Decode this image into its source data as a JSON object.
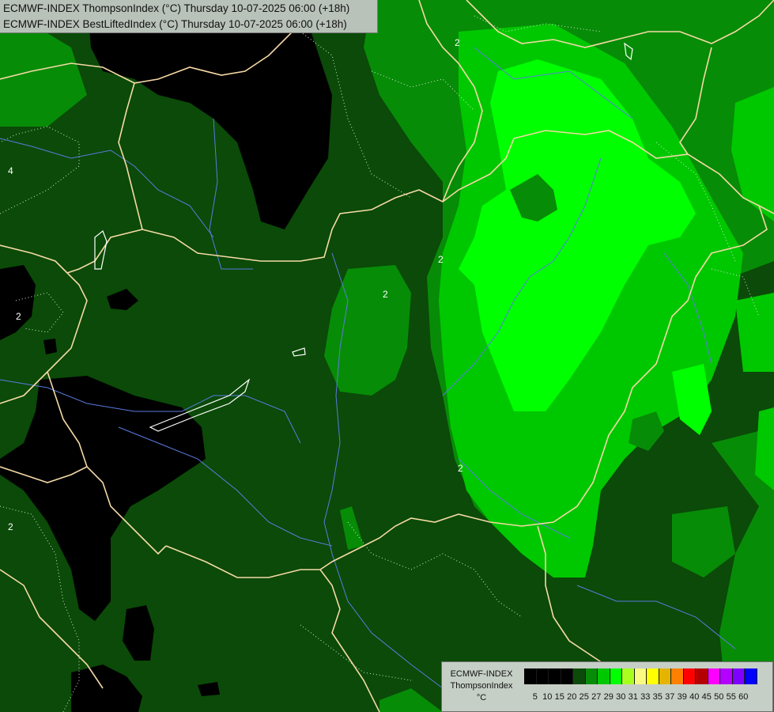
{
  "title": {
    "line1": "ECMWF-INDEX ThompsonIndex (°C) Thursday 10-07-2025 06:00 (+18h)",
    "line2": "ECMWF-INDEX BestLiftedIndex (°C) Thursday 10-07-2025 06:00 (+18h)"
  },
  "legend": {
    "model": "ECMWF-INDEX",
    "parameter": "ThompsonIndex",
    "unit": "°C",
    "colors": [
      "#000000",
      "#000000",
      "#000000",
      "#000000",
      "#0b4a08",
      "#078c07",
      "#00c800",
      "#00ff00",
      "#a8ff1e",
      "#fafa82",
      "#ffff00",
      "#e6b400",
      "#ff8000",
      "#ff0000",
      "#b40000",
      "#ff00ff",
      "#b400ff",
      "#8000ff",
      "#0000ff"
    ],
    "ticks": [
      "5",
      "10",
      "15",
      "20",
      "25",
      "27",
      "29",
      "30",
      "31",
      "33",
      "35",
      "37",
      "39",
      "40",
      "45",
      "50",
      "55",
      "60"
    ]
  },
  "contour_labels": [
    "2",
    "2",
    "2",
    "2",
    "2",
    "2",
    "4"
  ],
  "colors": {
    "very_dark_field": "#0b4a08",
    "mid_green": "#078c07",
    "light_green": "#00c800",
    "bright_green": "#00ff00",
    "low_black": "#000000",
    "borders": "#f5d9a6",
    "rivers": "#5a7be0"
  }
}
